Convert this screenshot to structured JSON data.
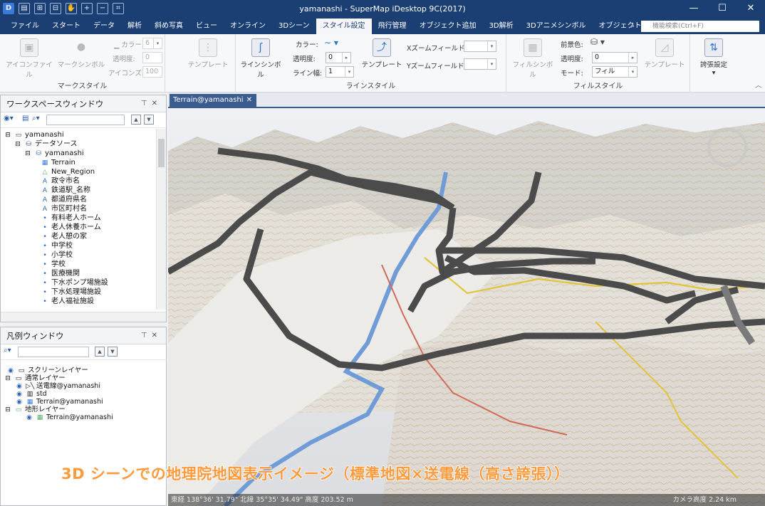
{
  "window": {
    "title": "yamanashi - SuperMap iDesktop 9C(2017)",
    "min_glyph": "—",
    "max_glyph": "☐",
    "close_glyph": "✕"
  },
  "menu": {
    "tabs": [
      "ファイル",
      "スタート",
      "データ",
      "解析",
      "斜め写真",
      "ビュー",
      "オンライン",
      "3Dシーン",
      "スタイル設定",
      "飛行管理",
      "オブジェクト追加",
      "3D解析",
      "3Dアニメシンボル",
      "オブジェクト操作"
    ],
    "active_tab": "スタイル設定",
    "search_placeholder": "機能検索(Ctrl+F)"
  },
  "ribbon": {
    "marker_group": {
      "label": "マークスタイル",
      "icon_file": "アイコンファイル",
      "marker_symbol": "マークシンボル",
      "color_label": "カラー",
      "size_value": "6",
      "opacity_label": "透明度:",
      "opacity_value": "0",
      "icon_zoom_label": "アイコンズーム:",
      "icon_zoom_value": "100",
      "template": "テンプレート"
    },
    "line_group": {
      "label": "ラインスタイル",
      "line_symbol": "ラインシンボル",
      "color_label": "カラー:",
      "opacity_label": "透明度:",
      "opacity_value": "0",
      "width_label": "ライン幅:",
      "width_value": "1",
      "template": "テンプレート",
      "x_zoom_field": "Xズームフィールド:",
      "y_zoom_field": "Yズームフィールド:"
    },
    "fill_group": {
      "label": "フィルスタイル",
      "fill_symbol": "フィルシンボル",
      "fg_color_label": "前景色:",
      "opacity_label": "透明度:",
      "opacity_value": "0",
      "mode_label": "モード:",
      "mode_value": "フィル",
      "template": "テンプレート"
    },
    "exaggeration": "誇張設定"
  },
  "workspace": {
    "title": "ワークスペースウィンドウ",
    "tree": [
      {
        "label": "yamanashi",
        "icon": "workspace-icon"
      },
      {
        "label": "データソース",
        "icon": "datasources-icon"
      },
      {
        "label": "yamanashi",
        "icon": "datasource-icon"
      },
      {
        "label": "Terrain",
        "icon": "grid-icon"
      },
      {
        "label": "New_Region",
        "icon": "region-icon"
      },
      {
        "label": "政令市名",
        "icon": "text-icon"
      },
      {
        "label": "鉄道駅_名称",
        "icon": "text-icon"
      },
      {
        "label": "都道府県名",
        "icon": "text-icon"
      },
      {
        "label": "市区町村名",
        "icon": "text-icon"
      },
      {
        "label": "有料老人ホーム",
        "icon": "point-icon"
      },
      {
        "label": "老人休養ホーム",
        "icon": "point-icon"
      },
      {
        "label": "老人憩の家",
        "icon": "point-icon"
      },
      {
        "label": "中学校",
        "icon": "point-icon"
      },
      {
        "label": "小学校",
        "icon": "point-icon"
      },
      {
        "label": "学校",
        "icon": "point-icon"
      },
      {
        "label": "医療機関",
        "icon": "point-icon"
      },
      {
        "label": "下水ポンプ場施設",
        "icon": "point-icon"
      },
      {
        "label": "下水処理場施設",
        "icon": "point-icon"
      },
      {
        "label": "老人福祉施設",
        "icon": "point-icon"
      }
    ]
  },
  "legend": {
    "title": "凡例ウィンドウ",
    "tree": [
      {
        "label": "スクリーンレイヤー"
      },
      {
        "label": "通常レイヤー"
      },
      {
        "label": "送電線@yamanashi"
      },
      {
        "label": "std"
      },
      {
        "label": "Terrain@yamanashi"
      },
      {
        "label": "地形レイヤー"
      },
      {
        "label": "Terrain@yamanashi"
      }
    ]
  },
  "document_tab": {
    "label": "Terrain@yamanashi"
  },
  "scene": {
    "caption": "3D シーンでの地理院地図表示イメージ（標準地図×送電線（高さ誇張））",
    "status_left": "東経 138°36' 31.79\"   北緯 35°35' 34.49\"   高度 203.52 m",
    "status_right": "カメラ高度 2.24 km"
  },
  "colors": {
    "title_bar": "#1c3f73",
    "caption": "#ff9a3d",
    "power_line": "#4b4b4b",
    "river": "#6f9bd6",
    "road_main": "#e2c43a",
    "road_rail": "#d06a5a"
  }
}
